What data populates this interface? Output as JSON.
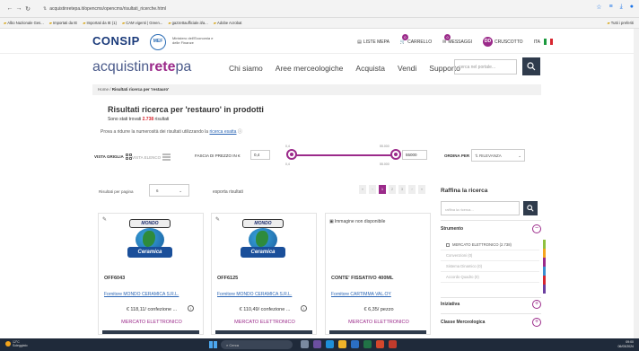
{
  "browser": {
    "url": "acquistinretepa.it/opencms/opencms/risultati_ricerche.html",
    "bookmarks": [
      "Albo Nazionale Ges...",
      "Importati da IE",
      "Importati da IE (1)",
      "CAM vigenti | Green...",
      "gazzettaufficiale.it/a...",
      "Adobe Acrobat"
    ],
    "bookmarks_right": "Tutti i preferiti"
  },
  "consip": {
    "logo": "CONSIP",
    "mef": "MEF",
    "mef_text": "Ministero dell'Economia e delle Finanze",
    "links": [
      {
        "label": "LISTE MEPA",
        "badge": ""
      },
      {
        "label": "CARRELLO",
        "badge": "0"
      },
      {
        "label": "MESSAGGI",
        "badge": "0"
      },
      {
        "label": "CRUSCOTTO",
        "badge": ""
      }
    ],
    "user_initials": "DD",
    "lang": "ITA"
  },
  "header": {
    "brand_a": "acquistin",
    "brand_b": "rete",
    "brand_c": "pa",
    "nav": [
      "Chi siamo",
      "Aree merceologiche",
      "Acquista",
      "Vendi",
      "Supporto"
    ],
    "search_placeholder": "cerca nel portale..."
  },
  "breadcrumb": {
    "home": "Home",
    "current": "Risultati ricerca per 'restauro'"
  },
  "results": {
    "title": "Risultati ricerca per 'restauro' in prodotti",
    "found_pre": "Sono stati trovati",
    "count": "2.738",
    "found_post": "risultati",
    "hint_pre": "Prova a ridurre la numerosità dei risultati utilizzando la",
    "hint_link": "ricerca esatta"
  },
  "filters": {
    "view_grid": "VISTA GRIGLIA",
    "view_list": "VISTA ELENCO",
    "price_label": "FASCIA DI PREZZO IN €",
    "price_min": "0,4",
    "price_max": "55000",
    "tick_min": "0,4",
    "tick_max": "55.000",
    "sort_label": "ORDINA PER",
    "sort_value": "RILEVANZA"
  },
  "listing": {
    "rpp_label": "Risultati per pagina",
    "rpp_value": "6",
    "export_label": "esporta risultati",
    "pages": [
      "«",
      "‹",
      "1",
      "2",
      "3",
      "›",
      "»"
    ]
  },
  "cards": [
    {
      "code": "OFF6043",
      "supplier": "Fornitore MONDO CERAMICA S.R.L.",
      "price": "€ 118,11/ confezione ...",
      "market": "MERCATO ELETTRONICO",
      "logo_top": "MONDO",
      "logo_bottom": "Ceramica"
    },
    {
      "code": "OFF6125",
      "supplier": "Fornitore MONDO CERAMICA S.R.L.",
      "price": "€ 110,49/ confezione ...",
      "market": "MERCATO ELETTRONICO",
      "logo_top": "MONDO",
      "logo_bottom": "Ceramica"
    },
    {
      "code": "CONTE' FISSATIVO 400ML",
      "supplier": "Fornitore CARTIMMA VAL.OY",
      "price": "€ 6,35/ pezzo",
      "market": "MERCATO ELETTRONICO",
      "noimg": "Immagine non disponibile"
    }
  ],
  "sidebar": {
    "title": "Raffina la ricerca",
    "input_placeholder": "raffina la ricerca...",
    "section_strumento": "Strumento",
    "options": [
      {
        "label": "MERCATO ELETTRONICO (2.738)",
        "dim": false
      },
      {
        "label": "Convenzioni (0)",
        "dim": true
      },
      {
        "label": "Sistema Dinamico (0)",
        "dim": true
      },
      {
        "label": "Accordo Quadro (0)",
        "dim": true
      }
    ],
    "section_iniziativa": "Iniziativa",
    "section_classe": "Classe Merceologica"
  },
  "taskbar": {
    "temp": "12°C",
    "weather": "Soleggiato",
    "search": "Cerca",
    "time": "09:00",
    "date": "06/03/2024"
  },
  "colors": {
    "accent": "#9b2a8a",
    "dark": "#2f3b4c",
    "link": "#2a65b4"
  }
}
